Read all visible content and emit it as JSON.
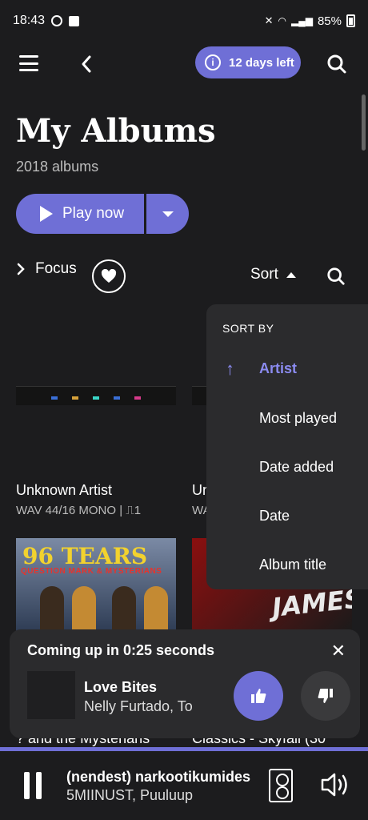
{
  "status": {
    "time": "18:43",
    "battery": "85%"
  },
  "header": {
    "trial_label": "12 days left"
  },
  "page": {
    "title": "My Albums",
    "count": "2018 albums"
  },
  "actions": {
    "play_label": "Play now",
    "focus_label": "Focus",
    "sort_label": "Sort"
  },
  "albums": [
    {
      "title": "Unknown Artist",
      "meta": "WAV 44/16 MONO | ⎍1"
    },
    {
      "title": "Un",
      "meta": "WA"
    }
  ],
  "covers": [
    {
      "title": "96 TEARS",
      "subtitle": "QUESTION MARK & MYSTERIANS"
    },
    {
      "title": "JAMES"
    }
  ],
  "sort_menu": {
    "header": "SORT BY",
    "items": [
      "Artist",
      "Most played",
      "Date added",
      "Date",
      "Album title"
    ],
    "active_index": 0
  },
  "upnext": {
    "header": "Coming up in 0:25 seconds",
    "song": "Love Bites",
    "artist": "Nelly Furtado, To",
    "peek_left": "? and the Mysterians",
    "peek_right": "Classics - Skyfall (30"
  },
  "now_playing": {
    "title": "(nendest) narkootikumides",
    "artist": "5MIINUST, Puuluup"
  },
  "colors": {
    "accent": "#6f6fd6",
    "background": "#1c1c1e",
    "panel": "#2b2b2d"
  },
  "icons": [
    "menu-icon",
    "back-icon",
    "info-icon",
    "search-icon",
    "play-icon",
    "chevron-down-icon",
    "chevron-right-icon",
    "heart-icon",
    "arrow-up-icon",
    "close-icon",
    "thumbs-up-icon",
    "thumbs-down-icon",
    "pause-icon",
    "speaker-icon",
    "volume-icon"
  ]
}
